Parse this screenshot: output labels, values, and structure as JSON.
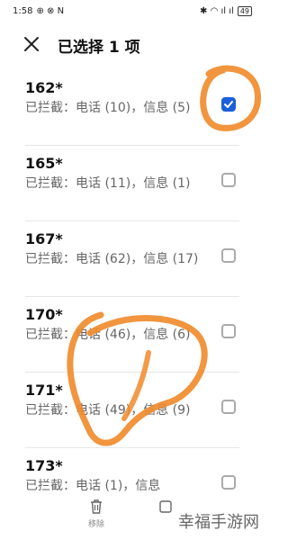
{
  "status_bar": {
    "time": "1:58",
    "left_icons": "⊕ ⊗ N",
    "right_icons": "✱ ◠ ıl ıl",
    "battery": "49"
  },
  "header": {
    "title": "已选择 1 项"
  },
  "items": [
    {
      "number": "162*",
      "detail": "已拦截：电话 (10)，信息 (5)",
      "checked": true
    },
    {
      "number": "165*",
      "detail": "已拦截：电话 (11)，信息 (1)",
      "checked": false
    },
    {
      "number": "167*",
      "detail": "已拦截：电话 (62)，信息 (17)",
      "checked": false
    },
    {
      "number": "170*",
      "detail": "已拦截：电话 (46)，信息 (6)",
      "checked": false
    },
    {
      "number": "171*",
      "detail": "已拦截：电话 (49)，信息 (9)",
      "checked": false
    },
    {
      "number": "173*",
      "detail": "已拦截：电话 (1)，信息",
      "checked": false
    }
  ],
  "bottom_bar": {
    "delete_label": "移除",
    "delete_icon": "trash-icon",
    "second_icon": "checkbox-icon"
  },
  "watermark": "幸福手游网",
  "colors": {
    "accent": "#1a5fdc",
    "annotation": "#f08a2a"
  }
}
